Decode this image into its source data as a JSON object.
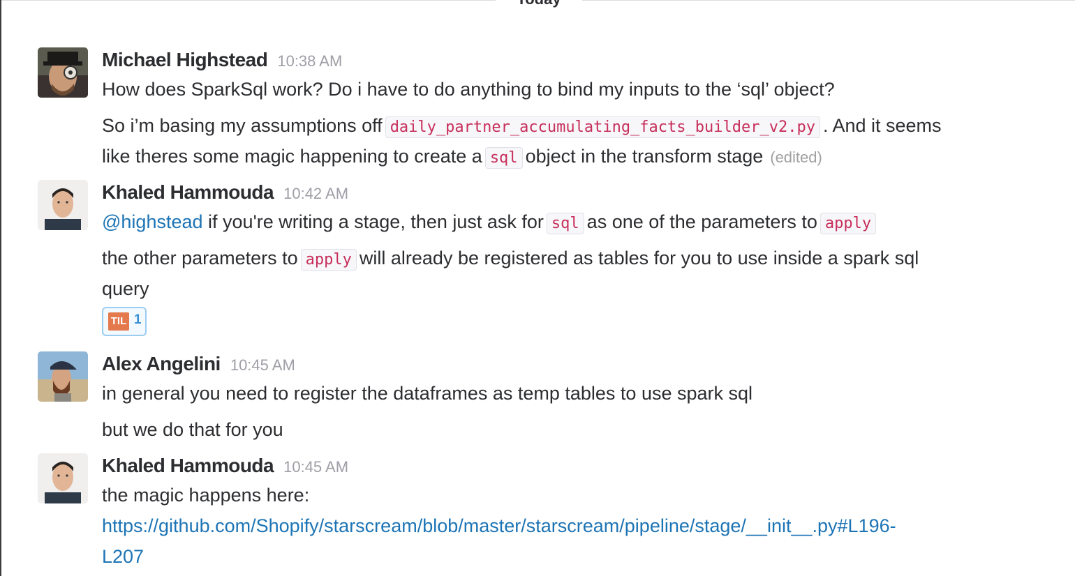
{
  "divider": {
    "label": "Today"
  },
  "messages": [
    {
      "sender": "Michael Highstead",
      "time": "10:38 AM",
      "line1": "How does SparkSql work?  Do i have to do anything to bind my inputs to the ‘sql’ object?",
      "line2_pre": "So i’m basing my assumptions off",
      "line2_code": "daily_partner_accumulating_facts_builder_v2.py",
      "line2_post": ".  And it seems",
      "line3_pre": "like theres some magic happening to create a",
      "line3_code": "sql",
      "line3_post": "object in the transform stage",
      "edited": "(edited)"
    },
    {
      "sender": "Khaled Hammouda",
      "time": "10:42 AM",
      "mention": "@highstead",
      "line1_a": "if you're writing a stage, then just ask for",
      "line1_code1": "sql",
      "line1_b": "as one of the parameters to",
      "line1_code2": "apply",
      "line2_a": "the other parameters to",
      "line2_code": "apply",
      "line2_b": "will already be registered as tables for you to use inside a spark sql",
      "line3": "query",
      "reaction": {
        "emoji_text": "TIL",
        "count": "1"
      }
    },
    {
      "sender": "Alex Angelini",
      "time": "10:45 AM",
      "line1": "in general you need to register the dataframes as temp tables to use spark sql",
      "line2": "but we do that for you"
    },
    {
      "sender": "Khaled Hammouda",
      "time": "10:45 AM",
      "line1": "the magic happens here:",
      "link_line1": "https://github.com/Shopify/starscream/blob/master/starscream/pipeline/stage/__init__.py#L196-",
      "link_line2": "L207"
    }
  ]
}
